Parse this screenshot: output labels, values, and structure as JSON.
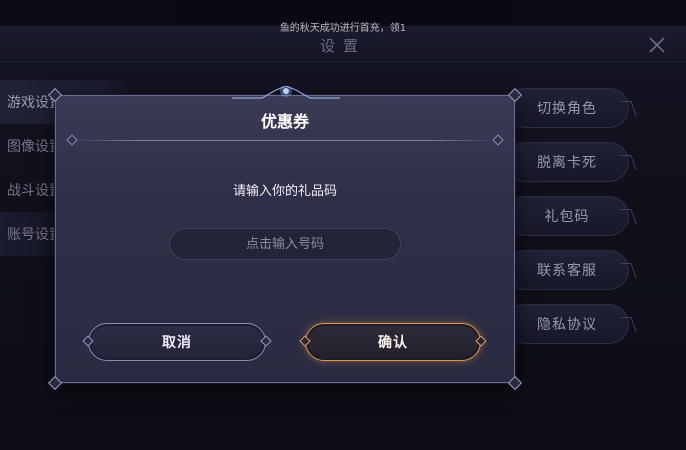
{
  "notice": {
    "text": "鱼的秋天成功进行首充，领1"
  },
  "settings": {
    "title": "设置",
    "side_items": [
      {
        "label": "游戏设置"
      },
      {
        "label": "图像设置"
      },
      {
        "label": "战斗设置"
      },
      {
        "label": "账号设置"
      }
    ],
    "right_buttons": [
      {
        "label": "切换角色"
      },
      {
        "label": "脱离卡死"
      },
      {
        "label": "礼包码"
      },
      {
        "label": "联系客服"
      },
      {
        "label": "隐私协议"
      }
    ]
  },
  "dialog": {
    "title": "优惠券",
    "prompt": "请输入你的礼品码",
    "input_value": "",
    "input_placeholder": "点击输入号码",
    "cancel_label": "取消",
    "confirm_label": "确认"
  },
  "colors": {
    "accent_orange": "#d99a4e",
    "panel_bg": "#2f3048",
    "background": "#0e0f1a"
  },
  "icons": [
    "close-icon"
  ]
}
